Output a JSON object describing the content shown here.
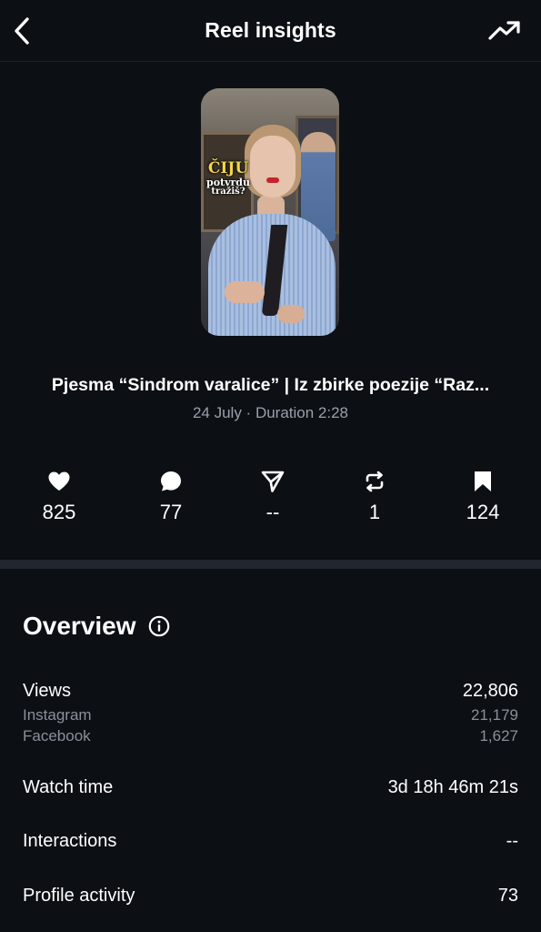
{
  "header": {
    "title": "Reel insights",
    "back_icon": "chevron-left-icon",
    "trend_icon": "trending-up-icon"
  },
  "thumbnail": {
    "overlay_line1": "ČIJU",
    "overlay_line2": "potvrdu",
    "overlay_line3": "tražiš?"
  },
  "reel": {
    "title": "Pjesma “Sindrom varalice” | Iz zbirke poezije “Raz...",
    "subtitle": "24 July · Duration 2:28"
  },
  "stats": [
    {
      "icon": "heart-icon",
      "value": "825"
    },
    {
      "icon": "comment-icon",
      "value": "77"
    },
    {
      "icon": "share-icon",
      "value": "--"
    },
    {
      "icon": "repost-icon",
      "value": "1"
    },
    {
      "icon": "bookmark-icon",
      "value": "124"
    }
  ],
  "overview": {
    "title": "Overview",
    "info_icon": "info-icon",
    "rows": {
      "views": {
        "label": "Views",
        "value": "22,806"
      },
      "instagram": {
        "label": "Instagram",
        "value": "21,179"
      },
      "facebook": {
        "label": "Facebook",
        "value": "1,627"
      },
      "watch_time": {
        "label": "Watch time",
        "value": "3d 18h 46m 21s"
      },
      "interactions": {
        "label": "Interactions",
        "value": "--"
      },
      "profile_activity": {
        "label": "Profile activity",
        "value": "73"
      }
    }
  },
  "colors": {
    "background": "#0c0f14",
    "muted_text": "#9aa0aa",
    "divider": "#22262e"
  }
}
